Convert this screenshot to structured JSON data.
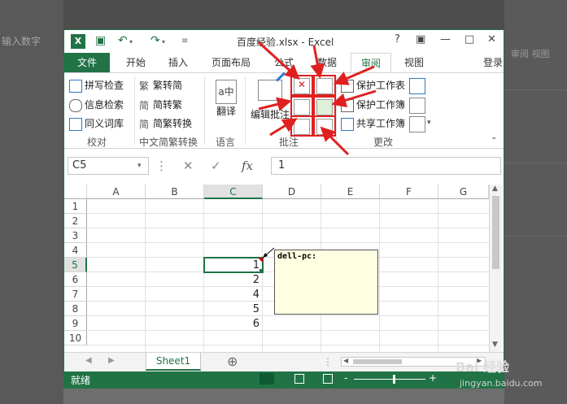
{
  "background": {
    "left_text": "输入数字",
    "right_text": "审阅 视图"
  },
  "titlebar": {
    "title": "百度经验.xlsx - Excel",
    "help": "?",
    "restore": "▣",
    "minimize": "—",
    "maximize": "□",
    "close": "✕"
  },
  "tabs": [
    {
      "label": "文件"
    },
    {
      "label": "开始"
    },
    {
      "label": "插入"
    },
    {
      "label": "页面布局"
    },
    {
      "label": "公式"
    },
    {
      "label": "数据"
    },
    {
      "label": "审阅"
    },
    {
      "label": "视图"
    }
  ],
  "login": "登录",
  "ribbon": {
    "proofing": {
      "spellcheck": "拼写检查",
      "research": "信息检索",
      "thesaurus": "同义词库",
      "group": "校对"
    },
    "chinese": {
      "trad_to_simp": "繁转简",
      "simp_to_trad": "简转繁",
      "convert": "简繁转换",
      "group": "中文简繁转换"
    },
    "language": {
      "translate": "翻译",
      "group": "语言"
    },
    "comments": {
      "edit": "编辑批注",
      "group": "批注"
    },
    "changes": {
      "protect_sheet": "保护工作表",
      "protect_workbook": "保护工作簿",
      "share_workbook": "共享工作簿",
      "group": "更改"
    }
  },
  "formula_bar": {
    "name_box": "C5",
    "fx": "fx",
    "value": "1"
  },
  "grid": {
    "columns": [
      "A",
      "B",
      "C",
      "D",
      "E",
      "F",
      "G"
    ],
    "rows": [
      "1",
      "2",
      "3",
      "4",
      "5",
      "6",
      "7",
      "8",
      "9",
      "10"
    ],
    "c_values": {
      "r5": "1",
      "r6": "2",
      "r7": "4",
      "r8": "5",
      "r9": "6"
    },
    "comment_author": "dell-pc:"
  },
  "sheet_tab": "Sheet1",
  "add_sheet": "⊕",
  "status": "就绪",
  "watermark": {
    "line1": "Bai 经验",
    "line2": "jingyan.baidu.com"
  }
}
